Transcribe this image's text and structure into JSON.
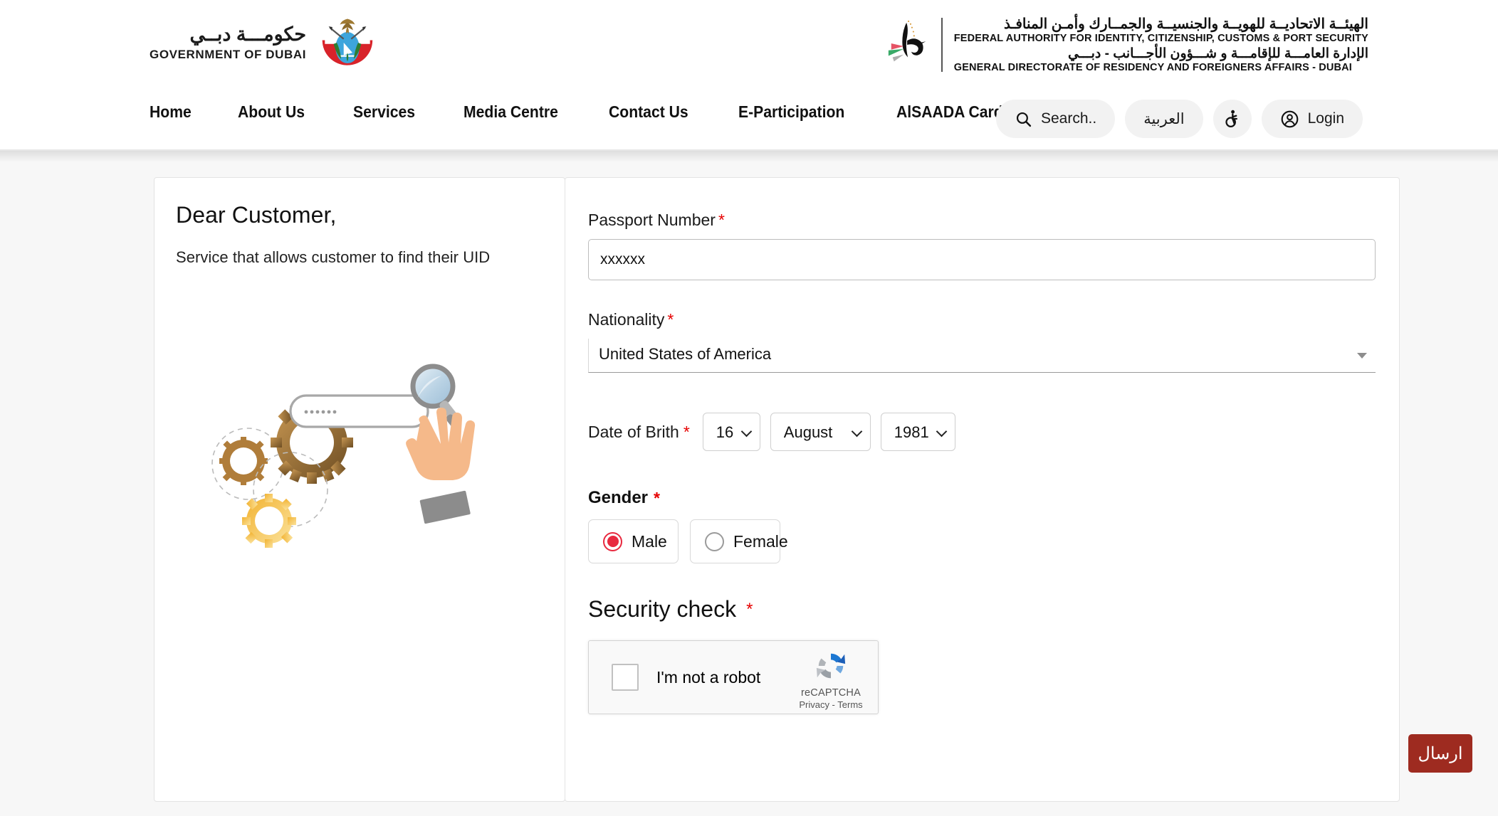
{
  "header": {
    "dubai_logo": {
      "arabic": "حكومـــة دبــي",
      "english": "GOVERNMENT OF DUBAI"
    },
    "federal_logo": {
      "arabic_line1": "الهيئــة الاتحاديــة للهويــة والجنسيــة والجمــارك وأمـن المنافـذ",
      "english_line1": "FEDERAL AUTHORITY FOR IDENTITY, CITIZENSHIP, CUSTOMS & PORT SECURITY",
      "arabic_line2": "الإدارة العامـــة للإقامـــة و شـــؤون الأجـــانب - دبـــي",
      "english_line2": "GENERAL DIRECTORATE OF RESIDENCY AND FOREIGNERS AFFAIRS - DUBAI"
    },
    "nav": [
      {
        "label": "Home"
      },
      {
        "label": "About Us"
      },
      {
        "label": "Services"
      },
      {
        "label": "Media Centre"
      },
      {
        "label": "Contact Us"
      },
      {
        "label": "E-Participation"
      },
      {
        "label": "AlSAADA Card"
      }
    ],
    "search_label": "Search..",
    "arabic_toggle": "العربية",
    "login_label": "Login"
  },
  "left_panel": {
    "title": "Dear Customer,",
    "description": "Service that allows customer to find their UID"
  },
  "form": {
    "passport": {
      "label": "Passport Number",
      "required_mark": "*",
      "value": "xxxxxx"
    },
    "nationality": {
      "label": "Nationality",
      "required_mark": "*",
      "value": "United States of America"
    },
    "dob": {
      "label": "Date of Brith",
      "required_mark": "*",
      "day": "16",
      "month": "August",
      "year": "1981"
    },
    "gender": {
      "label": "Gender",
      "required_mark": "*",
      "options": [
        {
          "label": "Male",
          "selected": true
        },
        {
          "label": "Female",
          "selected": false
        }
      ]
    },
    "security": {
      "label": "Security check",
      "required_mark": "*",
      "captcha_text": "I'm not a robot",
      "captcha_brand": "reCAPTCHA",
      "captcha_links": "Privacy - Terms"
    },
    "submit_label": "ارسال"
  },
  "colors": {
    "submit_bg": "#9e2b20",
    "required_red": "#e60000",
    "radio_selected": "#e8293f",
    "panel_border": "#e3e3e3",
    "page_bg": "#f7f7f7"
  }
}
